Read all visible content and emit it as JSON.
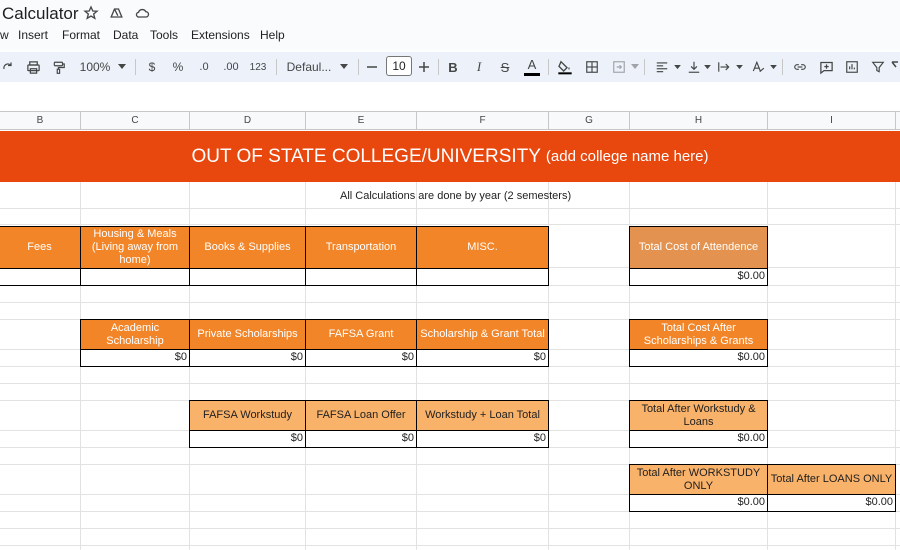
{
  "app": {
    "doc_title": "Calculator",
    "menu": [
      "w",
      "Insert",
      "Format",
      "Data",
      "Tools",
      "Extensions",
      "Help"
    ]
  },
  "toolbar": {
    "zoom": "100%",
    "currency": "$",
    "percent": "%",
    "decrease_decimal": ".0",
    "increase_decimal": ".00",
    "number_format": "123",
    "font": "Defaul...",
    "font_size": "10",
    "bold": "B",
    "italic": "I",
    "strike": "S",
    "text_color": "A"
  },
  "columns": [
    "B",
    "C",
    "D",
    "E",
    "F",
    "G",
    "H",
    "I"
  ],
  "sheet": {
    "banner_main": "OUT OF STATE COLLEGE/UNIVERSITY",
    "banner_sub": "(add college name here)",
    "subtitle": "All Calculations are done by year (2 semesters)",
    "costs": {
      "fees": "Fees",
      "housing": "Housing & Meals (Living away from home)",
      "books": "Books & Supplies",
      "transportation": "Transportation",
      "misc": "MISC.",
      "total_label": "Total Cost of Attendence",
      "total_value": "$0.00"
    },
    "scholarships": {
      "academic": "Academic Scholarship",
      "private": "Private Scholarships",
      "fafsa_grant": "FAFSA Grant",
      "total": "Scholarship & Grant Total",
      "academic_value": "$0",
      "private_value": "$0",
      "fafsa_grant_value": "$0",
      "total_value": "$0",
      "after_label": "Total Cost After Scholarships & Grants",
      "after_value": "$0.00"
    },
    "aid": {
      "workstudy": "FAFSA Workstudy",
      "loan": "FAFSA Loan Offer",
      "total": "Workstudy + Loan Total",
      "workstudy_value": "$0",
      "loan_value": "$0",
      "total_value": "$0",
      "after_label": "Total After Workstudy & Loans",
      "after_value": "$0.00"
    },
    "only": {
      "workstudy_label": "Total After WORKSTUDY ONLY",
      "workstudy_value": "$0.00",
      "loans_label": "Total After LOANS ONLY",
      "loans_value": "$0.00"
    }
  },
  "colors": {
    "banner": "#e8470d",
    "header_orange": "#f28528",
    "light_orange": "#f9b26a",
    "tan": "#e3934f"
  }
}
